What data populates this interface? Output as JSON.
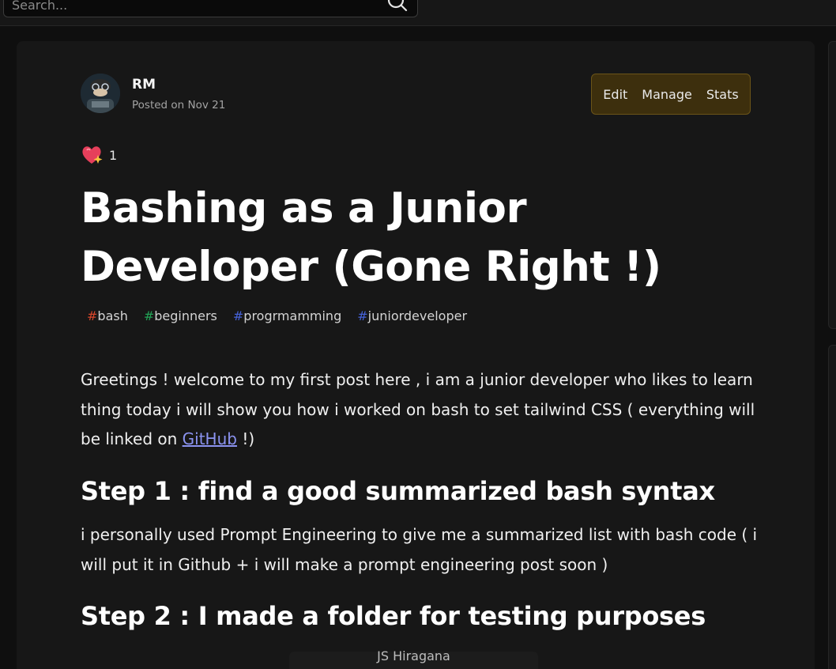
{
  "search": {
    "placeholder": "Search..."
  },
  "article": {
    "author": "RM",
    "posted": "Posted on Nov 21",
    "actions": [
      "Edit",
      "Manage",
      "Stats"
    ],
    "reaction_count": "1",
    "title": "Bashing as a Junior Developer (Gone Right !)",
    "tags": [
      {
        "hash": "#",
        "name": "bash",
        "color": "#d6462b"
      },
      {
        "hash": "#",
        "name": "beginners",
        "color": "#22a356"
      },
      {
        "hash": "#",
        "name": "progrmamming",
        "color": "#4562d9"
      },
      {
        "hash": "#",
        "name": "juniordeveloper",
        "color": "#4562d9"
      }
    ],
    "intro_before_link": "Greetings ! welcome to my first post here , i am a junior developer who likes to learn thing today i will show you how i worked on bash to set tailwind CSS ( everything will be linked on ",
    "intro_link": "GitHub",
    "intro_after_link": " !)",
    "step1_heading": "Step 1 : find a good summarized bash syntax",
    "step1_text": "i personally used Prompt Engineering to give me a summarized list with bash code ( i will put it in Github + i will make a prompt engineering post soon )",
    "step2_heading": "Step 2 : I made a folder for testing purposes",
    "image_caption": "JS Hiragana"
  },
  "colors": {
    "background": "#0f0f0f",
    "card": "#171717",
    "action_bg": "#3d2f0d",
    "link": "#8b93f0"
  }
}
